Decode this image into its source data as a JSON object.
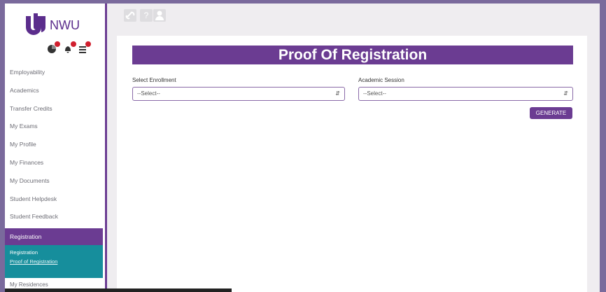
{
  "brand": {
    "name": "NWU",
    "primary": "#6b3c92",
    "teal": "#168e9c"
  },
  "notifications": [
    {
      "icon": "chart-icon"
    },
    {
      "icon": "bell-icon"
    },
    {
      "icon": "list-icon"
    }
  ],
  "toolbar": {
    "icons": [
      "link-icon",
      "help-icon",
      "user-icon"
    ],
    "help_glyph": "?"
  },
  "sidebar": {
    "items": [
      {
        "label": "Employability"
      },
      {
        "label": "Academics"
      },
      {
        "label": "Transfer Credits"
      },
      {
        "label": "My Exams"
      },
      {
        "label": "My Profile"
      },
      {
        "label": "My Finances"
      },
      {
        "label": "My Documents"
      },
      {
        "label": "Student Helpdesk"
      },
      {
        "label": "Student Feedback"
      }
    ],
    "active": "Registration",
    "sub": {
      "heading": "Registration",
      "link": "Proof of Registration"
    },
    "bottom": "My Residences"
  },
  "page": {
    "title": "Proof Of Registration",
    "enrollment": {
      "label": "Select Enrollment",
      "value": "--Select--"
    },
    "session": {
      "label": "Academic Session",
      "value": "--Select--"
    },
    "generate_label": "GENERATE"
  }
}
